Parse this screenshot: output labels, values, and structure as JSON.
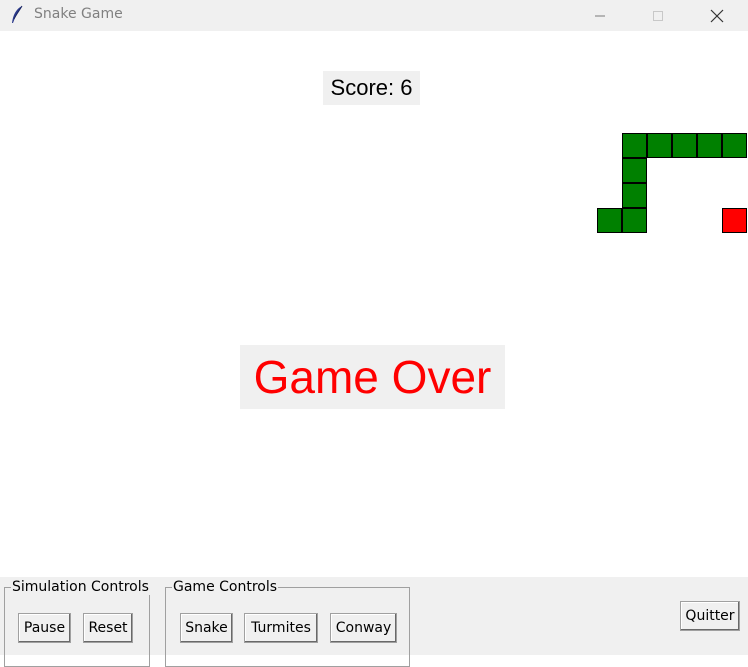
{
  "window": {
    "title": "Snake Game",
    "icon": "feather-icon",
    "controls": [
      "minimize-icon",
      "maximize-icon",
      "close-icon"
    ]
  },
  "game": {
    "score_text": "Score: 6",
    "status_text": "Game Over",
    "colors": {
      "snake": "#008000",
      "food": "#ff0000",
      "game_over_text": "#ff0000",
      "cell_border": "#000000"
    },
    "grid": {
      "cell_size_units": 1,
      "snake_cells": [
        [
          25,
          4
        ],
        [
          26,
          4
        ],
        [
          27,
          4
        ],
        [
          28,
          4
        ],
        [
          29,
          4
        ],
        [
          25,
          5
        ],
        [
          25,
          6
        ],
        [
          24,
          7
        ],
        [
          25,
          7
        ]
      ],
      "food_cell": [
        29,
        7
      ]
    }
  },
  "controls": {
    "simulation": {
      "legend": "Simulation Controls",
      "buttons": [
        "Pause",
        "Reset"
      ]
    },
    "game": {
      "legend": "Game Controls",
      "buttons": [
        "Snake",
        "Turmites",
        "Conway"
      ]
    },
    "quit_label": "Quitter"
  }
}
